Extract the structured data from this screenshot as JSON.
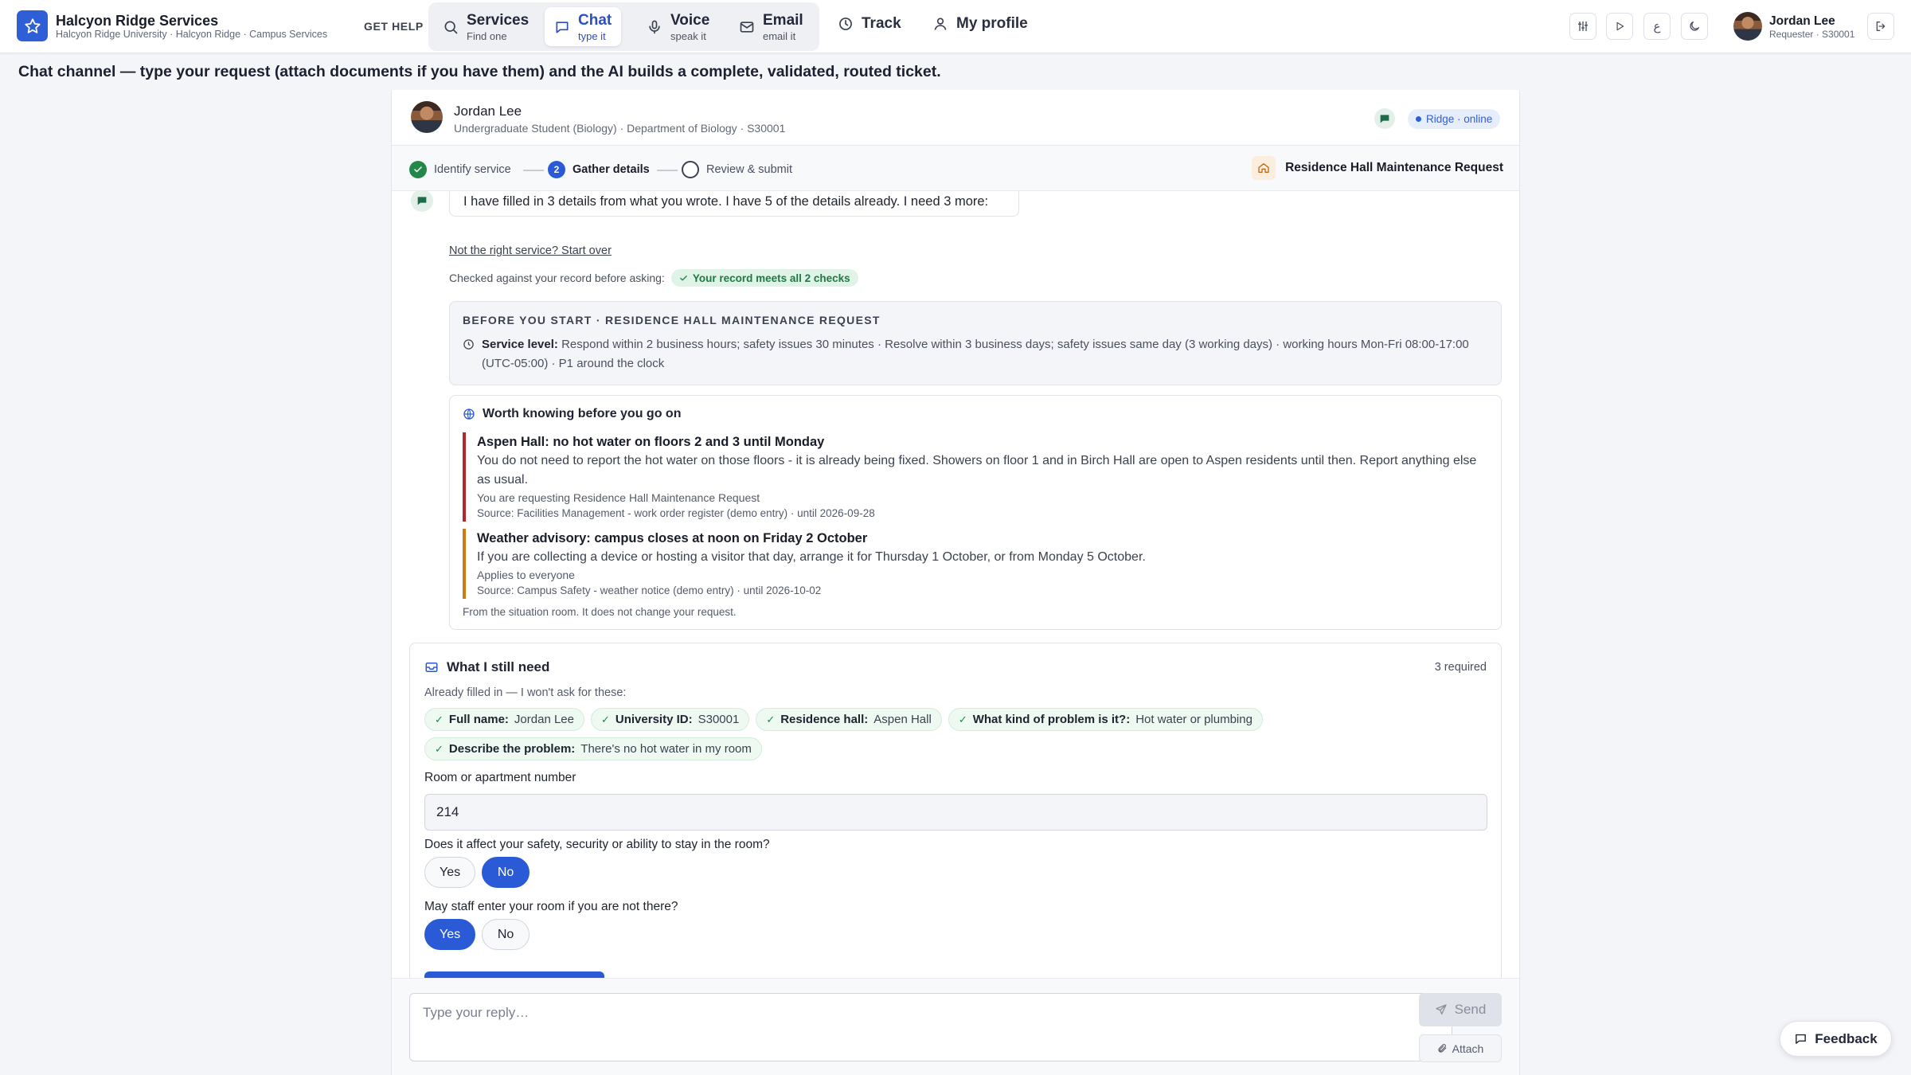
{
  "brand": {
    "name": "Halcyon Ridge Services",
    "sub": "Halcyon Ridge University · Halcyon Ridge · Campus Services"
  },
  "nav": {
    "get_help": "GET HELP",
    "services": {
      "main": "Services",
      "sub": "Find one"
    },
    "chat": {
      "main": "Chat",
      "sub": "type it"
    },
    "voice": {
      "main": "Voice",
      "sub": "speak it"
    },
    "email": {
      "main": "Email",
      "sub": "email it"
    },
    "track": "Track",
    "profile": "My profile"
  },
  "toolbar": {
    "lang_glyph": "ع"
  },
  "user": {
    "name": "Jordan Lee",
    "sub": "Requester · S30001"
  },
  "caption": "Chat channel — type your request (attach documents if you have them) and the AI builds a complete, validated, routed ticket.",
  "requester": {
    "name": "Jordan Lee",
    "meta": "Undergraduate Student (Biology) · Department of Biology · S30001",
    "status": "Ridge · online"
  },
  "steps": [
    {
      "label": "Identify service",
      "num": ""
    },
    {
      "label": "Gather details",
      "num": "2"
    },
    {
      "label": "Review & submit",
      "num": ""
    }
  ],
  "service_name": "Residence Hall Maintenance Request",
  "message": "I have filled in 3 details from what you wrote. I have 5 of the details already. I need 3 more:",
  "start_over": "Not the right service? Start over",
  "checked": {
    "label": "Checked against your record before asking:",
    "badge": "Your record meets all 2 checks"
  },
  "before": {
    "title": "BEFORE YOU START · RESIDENCE HALL MAINTENANCE REQUEST",
    "sl_label": "Service level:",
    "sl_text": "Respond within 2 business hours; safety issues 30 minutes · Resolve within 3 business days; safety issues same day (3 working days) · working hours Mon-Fri 08:00-17:00 (UTC-05:00) · P1 around the clock"
  },
  "worth": {
    "title": "Worth knowing before you go on",
    "notes": [
      {
        "title": "Aspen Hall: no hot water on floors 2 and 3 until Monday",
        "body": "You do not need to report the hot water on those floors - it is already being fixed. Showers on floor 1 and in Birch Hall are open to Aspen residents until then. Report anything else as usual.",
        "scope": "You are requesting Residence Hall Maintenance Request",
        "source": "Source: Facilities Management - work order register (demo entry) · until 2026-09-28"
      },
      {
        "title": "Weather advisory: campus closes at noon on Friday 2 October",
        "body": "If you are collecting a device or hosting a visitor that day, arrange it for Thursday 1 October, or from Monday 5 October.",
        "scope": "Applies to everyone",
        "source": "Source: Campus Safety - weather notice (demo entry) · until 2026-10-02"
      }
    ],
    "footer": "From the situation room. It does not change your request."
  },
  "still": {
    "title": "What I still need",
    "required": "3 required",
    "already": "Already filled in — I won't ask for these:",
    "chips": [
      {
        "k": "Full name:",
        "v": "Jordan Lee"
      },
      {
        "k": "University ID:",
        "v": "S30001"
      },
      {
        "k": "Residence hall:",
        "v": "Aspen Hall"
      },
      {
        "k": "What kind of problem is it?:",
        "v": "Hot water or plumbing"
      },
      {
        "k": "Describe the problem:",
        "v": "There's no hot water in my room"
      }
    ],
    "room_label": "Room or apartment number",
    "room_value": "214",
    "q1": "Does it affect your safety, security or ability to stay in the room?",
    "q1_yes": "Yes",
    "q1_no": "No",
    "q1_selected": "No",
    "q2": "May staff enter your room if you are not there?",
    "q2_yes": "Yes",
    "q2_no": "No",
    "q2_selected": "Yes"
  },
  "composer": {
    "placeholder": "Type your reply…",
    "send": "Send",
    "attach": "Attach"
  },
  "feedback": "Feedback",
  "colors": {
    "accent": "#2a5ad6",
    "success": "#23874a",
    "alert_red": "#b3262d",
    "alert_orange": "#d27a12"
  }
}
